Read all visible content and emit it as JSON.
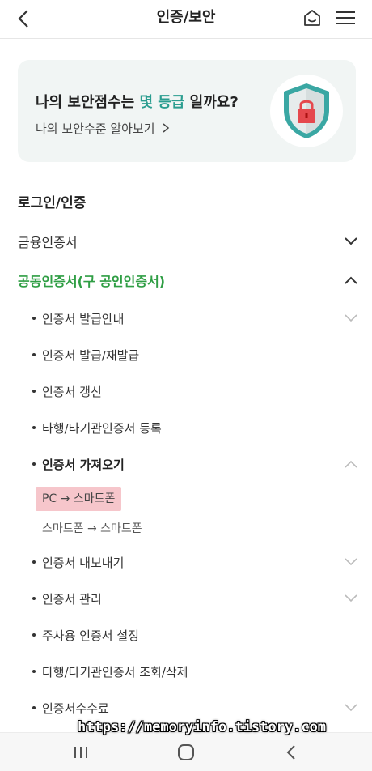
{
  "header": {
    "title": "인증/보안",
    "back_icon": "chevron-left-icon",
    "home_icon": "home-icon",
    "menu_icon": "hamburger-menu-icon"
  },
  "banner": {
    "headline_prefix": "나의 보안점수는 ",
    "headline_accent": "몇 등급",
    "headline_suffix": " 일까요?",
    "sublink": "나의 보안수준 알아보기",
    "shield_icon": "shield-lock-icon",
    "accent_color": "#2a9d8f"
  },
  "section": {
    "title": "로그인/인증"
  },
  "menu": {
    "item1": {
      "label": "금융인증서"
    },
    "item2": {
      "label": "공동인증서(구 공인인증서)",
      "color": "#2f9e44"
    }
  },
  "submenu": {
    "s1": "인증서 발급안내",
    "s2": "인증서 발급/재발급",
    "s3": "인증서 갱신",
    "s4": "타행/타기관인증서 등록",
    "s5": "인증서 가져오기",
    "s6": "인증서 내보내기",
    "s7": "인증서 관리",
    "s8": "주사용 인증서 설정",
    "s9": "타행/타기관인증서 조회/삭제",
    "s10": "인증서수수료"
  },
  "import_options": {
    "opt1": "PC → 스마트폰",
    "opt2": "스마트폰 → 스마트폰"
  },
  "watermark": "https://memoryinfo.tistory.com",
  "navbar": {
    "recent_icon": "recent-apps-icon",
    "home_icon": "home-circle-icon",
    "back_icon": "back-icon"
  }
}
